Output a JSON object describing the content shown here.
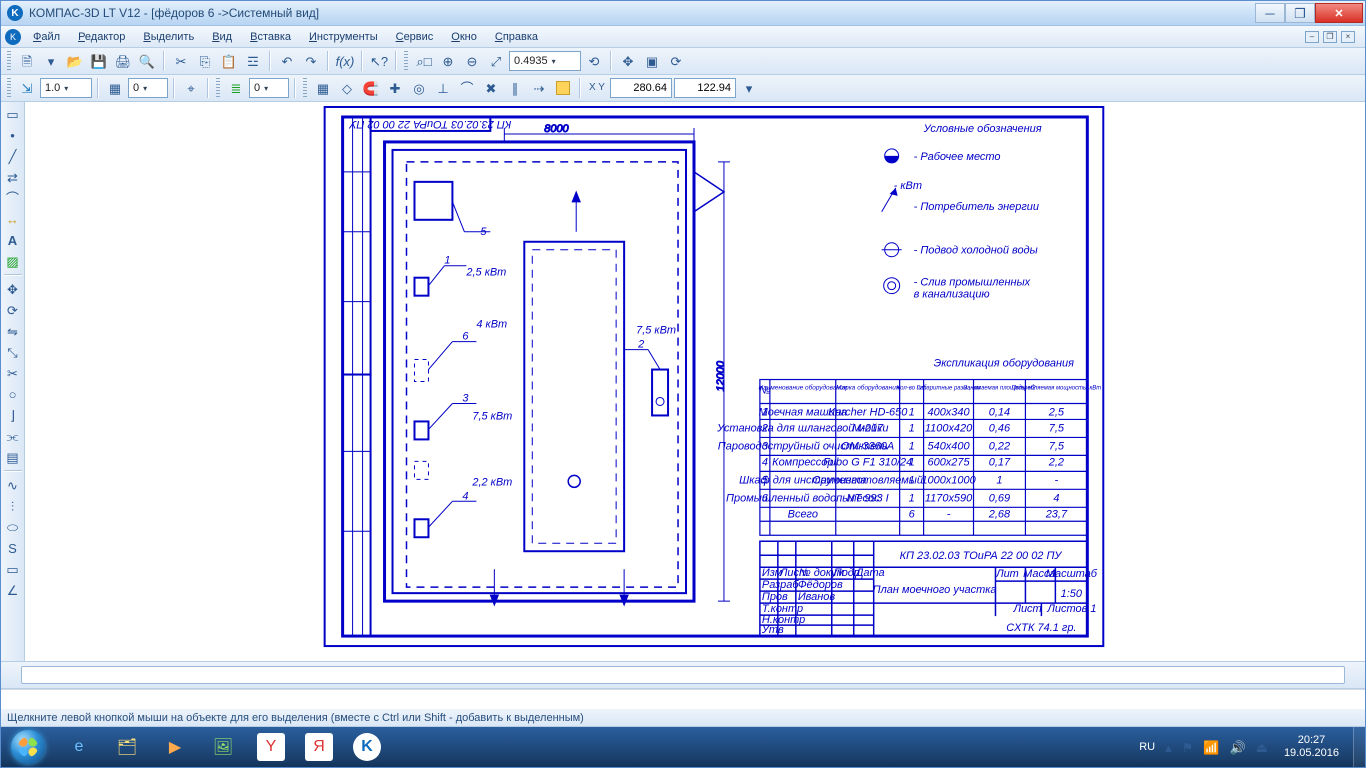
{
  "window": {
    "title": "КОМПАС-3D LT V12 - [фёдоров 6 ->Системный вид]",
    "app_token": "K"
  },
  "menu": [
    "Файл",
    "Редактор",
    "Выделить",
    "Вид",
    "Вставка",
    "Инструменты",
    "Сервис",
    "Окно",
    "Справка"
  ],
  "toolbar1": {
    "zoom_value": "0.4935"
  },
  "toolbar2": {
    "line_weight": "1.0",
    "int1": "0",
    "int2": "0",
    "coord_x": "280.64",
    "coord_y": "122.94"
  },
  "status": "Щелкните левой кнопкой мыши на объекте для его выделения (вместе с Ctrl или Shift - добавить к выделенным)",
  "tray": {
    "lang": "RU",
    "time": "20:27",
    "date": "19.05.2016"
  },
  "drawing": {
    "dim_w": "8000",
    "dim_h": "12000",
    "legend_title": "Условные обозначения",
    "legend": [
      "- Рабочее место",
      "- Потребитель энергии",
      "- кВт",
      "- Подвод холодной воды",
      "- Слив промышленных",
      "  в канализацию"
    ],
    "callouts": {
      "c5": "5",
      "c1": "1",
      "p1": "2,5 кВт",
      "c6": "6",
      "p6": "4 кВт",
      "c3a": "3",
      "p3a": "7,5 кВт",
      "c4": "4",
      "p4": "2,2 кВт",
      "c2": "2",
      "p2": "7,5 кВт"
    },
    "spec_title": "Экспликация оборудования",
    "spec_headers": [
      "№",
      "Наименование оборудования",
      "Марка оборудования",
      "Кол-во шт",
      "Габаритные разм., мм",
      "Занимаемая площадь, м2",
      "Потребляемая мощность, кВт"
    ],
    "spec_rows": [
      [
        "1",
        "Моечная машина",
        "Karcher HD-650",
        "1",
        "400x340",
        "0,14",
        "2,5"
      ],
      [
        "2",
        "Установка для шланговой мойки",
        "М-217",
        "1",
        "1100x420",
        "0,46",
        "7,5"
      ],
      [
        "3",
        "Пароводоструйный очиститель",
        "ОМ-3360А",
        "1",
        "540x400",
        "0,22",
        "7,5"
      ],
      [
        "4",
        "Компрессор",
        "Fubo G F1 310/24",
        "1",
        "600x275",
        "0,17",
        "2,2"
      ],
      [
        "5",
        "Шкаф для инструмента",
        "Самоизготовляемый",
        "1",
        "1000x1000",
        "1",
        "-"
      ],
      [
        "6",
        "Промышленный водопылесос",
        "NT 993 I",
        "1",
        "1170x590",
        "0,69",
        "4"
      ]
    ],
    "spec_total": [
      "",
      "Всего",
      "",
      "6",
      "-",
      "2,68",
      "23,7"
    ],
    "stamp": {
      "code": "КП 23.02.03 ТОиРА 22 00 02 ПУ",
      "title": "План моечного участка",
      "group": "СХТК 74.1 гр.",
      "scale": "1:50",
      "cols": [
        "Лит",
        "Масса",
        "Масштаб"
      ],
      "sheet1": "Лист",
      "sheet2": "Листов   1",
      "rows": [
        [
          "Изм",
          "Лист",
          "№ докум",
          "Подп",
          "Дата"
        ],
        [
          "Разраб",
          "Фёдоров",
          "",
          "",
          ""
        ],
        [
          "Пров",
          "Иванов",
          "",
          "",
          ""
        ],
        [
          "Т.контр",
          "",
          "",
          "",
          ""
        ],
        [
          "Н.контр",
          "",
          "",
          "",
          ""
        ],
        [
          "Утв",
          "",
          "",
          "",
          ""
        ]
      ]
    },
    "side_label": "КП 23.02.03 ТОиРА 22 00 02 ПУ"
  }
}
